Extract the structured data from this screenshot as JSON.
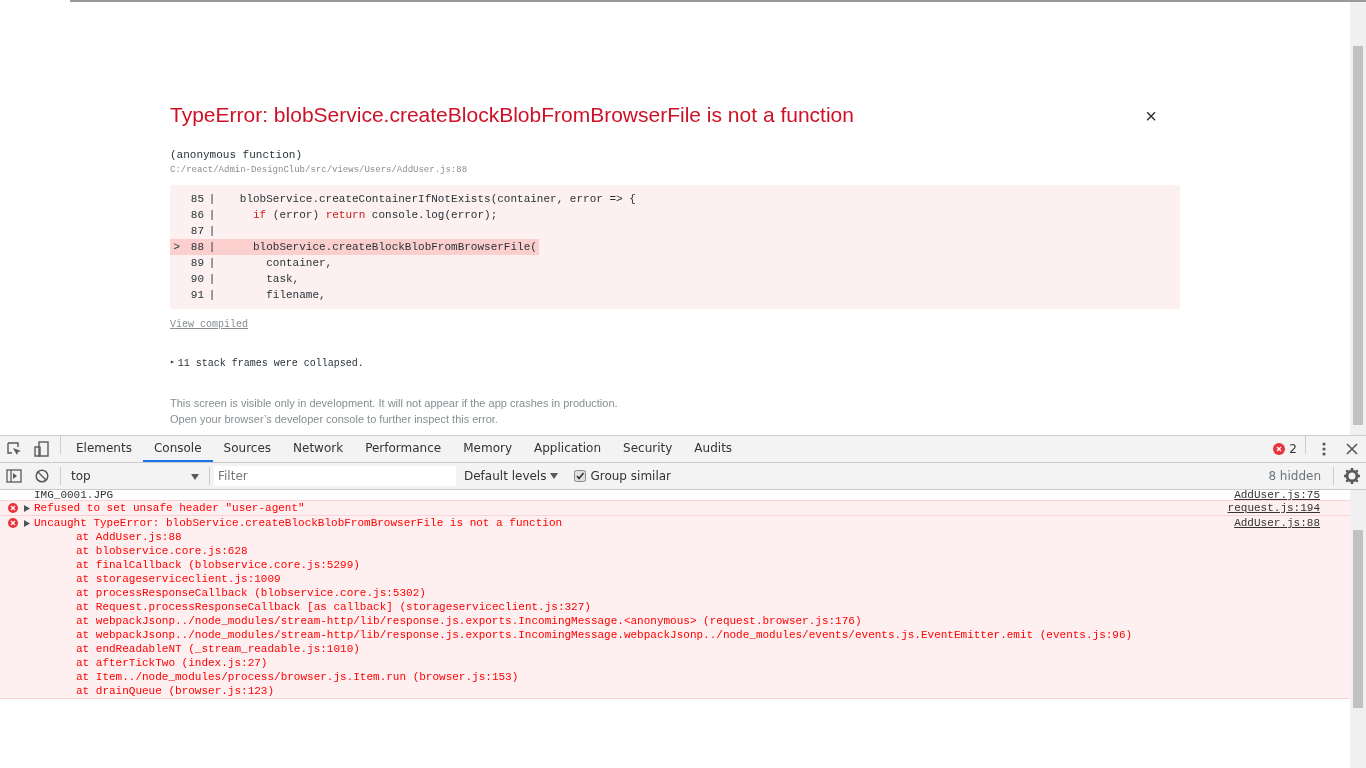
{
  "overlay": {
    "title": "TypeError: blobService.createBlockBlobFromBrowserFile is not a function",
    "close": "×",
    "frame_name": "(anonymous function)",
    "frame_file": "C:/react/Admin-DesignClub/src/views/Users/AddUser.js:88",
    "code_lines": [
      {
        "number": "85",
        "gutter": "|",
        "selected": false,
        "tokens": [
          {
            "kind": "plain",
            "text": "   blobService.createContainerIfNotExists(container, error => {"
          }
        ]
      },
      {
        "number": "86",
        "gutter": "|",
        "selected": false,
        "tokens": [
          {
            "kind": "keyword",
            "text": "     if"
          },
          {
            "kind": "plain",
            "text": " (error) "
          },
          {
            "kind": "keyword",
            "text": "return"
          },
          {
            "kind": "plain",
            "text": " console.log(error);"
          }
        ]
      },
      {
        "number": "87",
        "gutter": "|",
        "selected": false
      },
      {
        "marker": ">",
        "number": "88",
        "gutter": "|",
        "selected": true,
        "tokens": [
          {
            "kind": "plain",
            "text": "     blobService.createBlockBlobFromBrowserFile("
          }
        ]
      },
      {
        "number": "89",
        "gutter": "|",
        "selected": false,
        "tokens": [
          {
            "kind": "plain",
            "text": "       container,"
          }
        ]
      },
      {
        "number": "90",
        "gutter": "|",
        "selected": false,
        "tokens": [
          {
            "kind": "plain",
            "text": "       task,"
          }
        ]
      },
      {
        "number": "91",
        "gutter": "|",
        "selected": false,
        "tokens": [
          {
            "kind": "plain",
            "text": "       filename,"
          }
        ]
      }
    ],
    "view_compiled": "View compiled",
    "collapsed_marker": "▸",
    "collapsed": "11 stack frames were collapsed.",
    "footer": [
      "This screen is visible only in development. It will not appear if the app crashes in production.",
      "Open your browser’s developer console to further inspect this error."
    ]
  },
  "devtools": {
    "tabs": [
      {
        "label": "Elements",
        "selected": false
      },
      {
        "label": "Console",
        "selected": true
      },
      {
        "label": "Sources",
        "selected": false
      },
      {
        "label": "Network",
        "selected": false
      },
      {
        "label": "Performance",
        "selected": false
      },
      {
        "label": "Memory",
        "selected": false
      },
      {
        "label": "Application",
        "selected": false
      },
      {
        "label": "Security",
        "selected": false
      },
      {
        "label": "Audits",
        "selected": false
      }
    ],
    "error_count": "2",
    "context": "top",
    "filter_placeholder": "Filter",
    "levels": "Default levels",
    "group_similar": {
      "label": "Group similar",
      "checked": true
    },
    "hidden": "8 hidden",
    "messages": [
      {
        "kind": "log",
        "text": "IMG_0001.JPG",
        "source": "AddUser.js:75"
      },
      {
        "kind": "error",
        "text": "Refused to set unsafe header \"user-agent\"",
        "source": "request.js:194"
      },
      {
        "kind": "error",
        "text": "Uncaught TypeError: blobService.createBlockBlobFromBrowserFile is not a function",
        "source": "AddUser.js:88",
        "frames": [
          {
            "before": "at ",
            "link": "AddUser.js:88"
          },
          {
            "before": "at ",
            "link": "blobservice.core.js:628"
          },
          {
            "before": "at finalCallback (",
            "link": "blobservice.core.js:5299",
            "after": ")"
          },
          {
            "before": "at ",
            "link": "storageserviceclient.js:1009"
          },
          {
            "before": "at processResponseCallback (",
            "link": "blobservice.core.js:5302",
            "after": ")"
          },
          {
            "before": "at Request.processResponseCallback [as callback] (",
            "link": "storageserviceclient.js:327",
            "after": ")"
          },
          {
            "before": "at webpackJsonp../node_modules/stream-http/lib/response.js.exports.IncomingMessage.<anonymous> (",
            "link": "request.browser.js:176",
            "after": ")"
          },
          {
            "before": "at webpackJsonp../node_modules/stream-http/lib/response.js.exports.IncomingMessage.webpackJsonp../node_modules/events/events.js.EventEmitter.emit (",
            "link": "events.js:96",
            "after": ")"
          },
          {
            "before": "at endReadableNT (",
            "link": "_stream_readable.js:1010",
            "after": ")"
          },
          {
            "before": "at afterTickTwo (",
            "link": "index.js:27",
            "after": ")"
          },
          {
            "before": "at Item../node_modules/process/browser.js.Item.run (",
            "link": "browser.js:153",
            "after": ")"
          },
          {
            "before": "at drainQueue (",
            "link": "browser.js:123",
            "after": ")"
          }
        ]
      }
    ]
  }
}
